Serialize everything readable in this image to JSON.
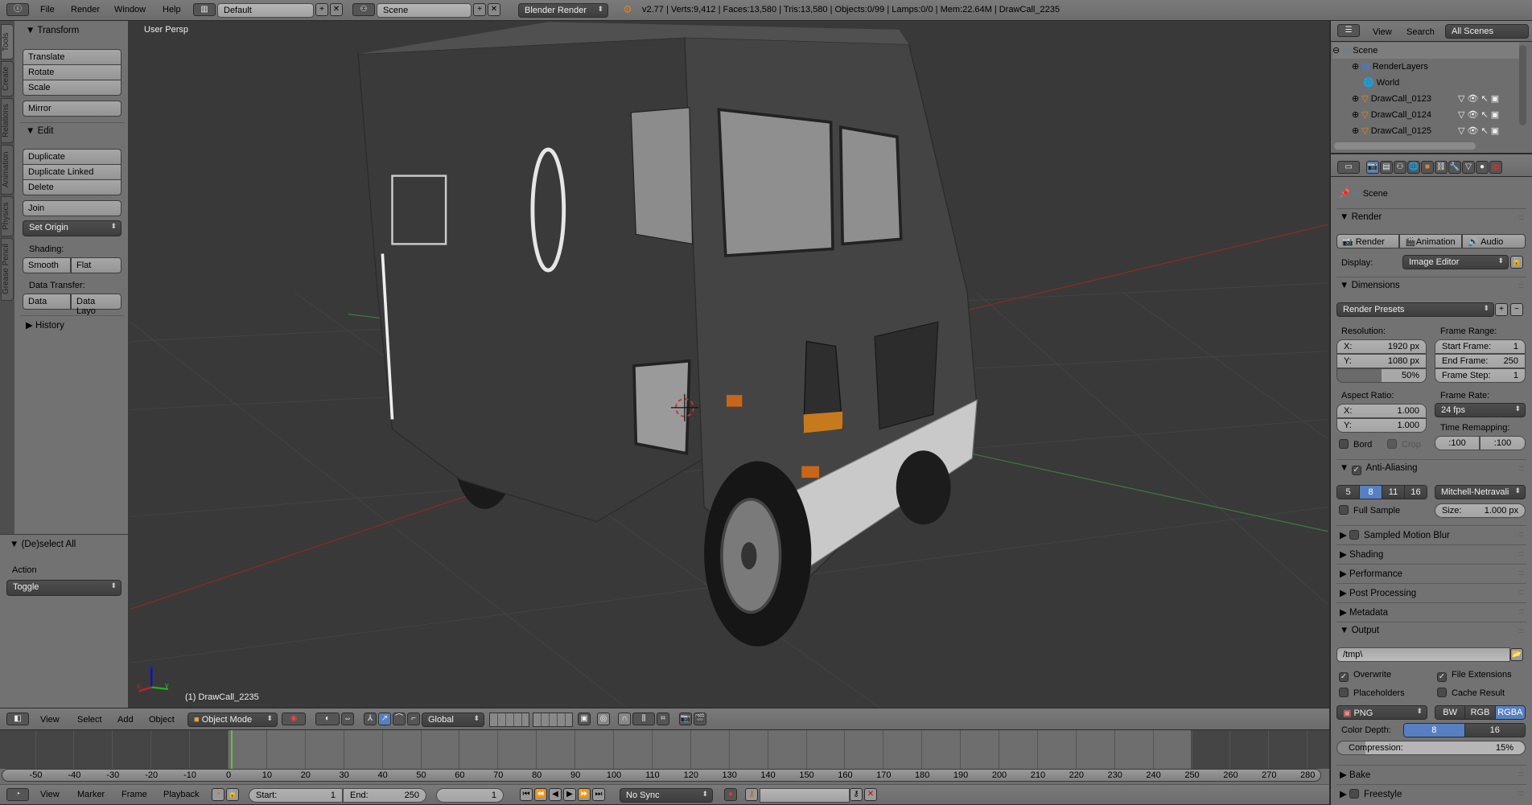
{
  "topbar": {
    "menus": [
      "File",
      "Render",
      "Window",
      "Help"
    ],
    "layout": "Default",
    "scene": "Scene",
    "engine": "Blender Render",
    "stats": "v2.77 | Verts:9,412 | Faces:13,580 | Tris:13,580 | Objects:0/99 | Lamps:0/0 | Mem:22.64M | DrawCall_2235"
  },
  "toolshelf": {
    "tabs": [
      "Tools",
      "Create",
      "Relations",
      "Animation",
      "Physics",
      "Grease Pencil"
    ],
    "transform_title": "Transform",
    "translate": "Translate",
    "rotate": "Rotate",
    "scale": "Scale",
    "mirror": "Mirror",
    "edit_title": "Edit",
    "duplicate": "Duplicate",
    "duplicate_linked": "Duplicate Linked",
    "delete": "Delete",
    "join": "Join",
    "set_origin": "Set Origin",
    "shading_label": "Shading:",
    "smooth": "Smooth",
    "flat": "Flat",
    "data_transfer_label": "Data Transfer:",
    "data": "Data",
    "data_layout": "Data Layo",
    "history_title": "History"
  },
  "operator": {
    "title": "(De)select All",
    "action_label": "Action",
    "action_value": "Toggle"
  },
  "viewport": {
    "view_label": "User Persp",
    "object_label": "(1) DrawCall_2235",
    "axis_x": "x",
    "axis_y": "y",
    "axis_z": "z"
  },
  "view3d_header": {
    "menus": [
      "View",
      "Select",
      "Add",
      "Object"
    ],
    "mode": "Object Mode",
    "orientation": "Global"
  },
  "timeline": {
    "ticks": [
      -50,
      -40,
      -30,
      -20,
      -10,
      0,
      10,
      20,
      30,
      40,
      50,
      60,
      70,
      80,
      90,
      100,
      110,
      120,
      130,
      140,
      150,
      160,
      170,
      180,
      190,
      200,
      210,
      220,
      230,
      240,
      250,
      260,
      270,
      280
    ],
    "current_frame": 1,
    "range_start": 0,
    "range_end": 250
  },
  "timeline_header": {
    "menus": [
      "View",
      "Marker",
      "Frame",
      "Playback"
    ],
    "start_label": "Start:",
    "start_value": "1",
    "end_label": "End:",
    "end_value": "250",
    "current_value": "1",
    "sync": "No Sync"
  },
  "outliner": {
    "menus": [
      "View",
      "Search"
    ],
    "filter": "All Scenes",
    "items": [
      {
        "label": "Scene",
        "depth": 0
      },
      {
        "label": "RenderLayers",
        "depth": 1
      },
      {
        "label": "World",
        "depth": 1
      },
      {
        "label": "DrawCall_0123",
        "depth": 1
      },
      {
        "label": "DrawCall_0124",
        "depth": 1
      },
      {
        "label": "DrawCall_0125",
        "depth": 1
      }
    ]
  },
  "properties": {
    "breadcrumb": "Scene",
    "render": {
      "title": "Render",
      "render_btn": "Render",
      "animation_btn": "Animation",
      "audio_btn": "Audio",
      "display_label": "Display:",
      "display_value": "Image Editor"
    },
    "dimensions": {
      "title": "Dimensions",
      "presets": "Render Presets",
      "resolution_label": "Resolution:",
      "res_x_label": "X:",
      "res_x": "1920 px",
      "res_y_label": "Y:",
      "res_y": "1080 px",
      "res_pct": "50%",
      "res_pct_value": 50,
      "frame_range_label": "Frame Range:",
      "start_label": "Start Frame:",
      "start": "1",
      "end_label": "End Frame:",
      "end": "250",
      "step_label": "Frame Step:",
      "step": "1",
      "aspect_label": "Aspect Ratio:",
      "asp_x_label": "X:",
      "asp_x": "1.000",
      "asp_y_label": "Y:",
      "asp_y": "1.000",
      "frame_rate_label": "Frame Rate:",
      "frame_rate": "24 fps",
      "time_remap_label": "Time Remapping:",
      "remap_old": ":100",
      "remap_new": ":100",
      "bord": "Bord",
      "crop": "Crop"
    },
    "anti_aliasing": {
      "title": "Anti-Aliasing",
      "samples": [
        "5",
        "8",
        "11",
        "16"
      ],
      "selected": "8",
      "filter": "Mitchell-Netravali",
      "full_sample": "Full Sample",
      "size_label": "Size:",
      "size": "1.000 px"
    },
    "collapsed_panels": [
      "Sampled Motion Blur",
      "Shading",
      "Performance",
      "Post Processing",
      "Metadata"
    ],
    "output": {
      "title": "Output",
      "path": "/tmp\\",
      "overwrite": "Overwrite",
      "file_extensions": "File Extensions",
      "placeholders": "Placeholders",
      "cache_result": "Cache Result",
      "format": "PNG",
      "color_modes": [
        "BW",
        "RGB",
        "RGBA"
      ],
      "color_mode_selected": "RGBA",
      "color_depth_label": "Color Depth:",
      "depths": [
        "8",
        "16"
      ],
      "depth_selected": "8",
      "compression_label": "Compression:",
      "compression": "15%",
      "compression_value": 15
    },
    "bake": "Bake",
    "freestyle": "Freestyle"
  },
  "colors": {
    "accent": "#5680c2",
    "viewport_bg": "#393939",
    "header_bg": "#727272",
    "frame_cursor": "#60c040"
  }
}
